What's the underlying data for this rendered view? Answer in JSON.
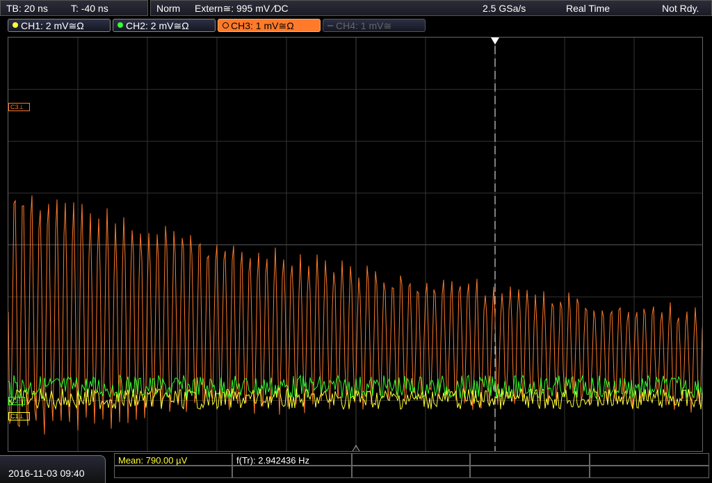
{
  "topbar": {
    "timebase": "TB: 20 ns",
    "trigger_time": "T: -40 ns",
    "mode": "Norm",
    "source": "Extern≅: 995 mV ⁄DC",
    "sample_rate": "2.5 GSa/s",
    "acq_mode": "Real Time",
    "status": "Not Rdy."
  },
  "channels": [
    {
      "label": "CH1: 2 mV≅Ω",
      "color": "#ffff33",
      "state": "on"
    },
    {
      "label": "CH2: 2 mV≅Ω",
      "color": "#33ff33",
      "state": "on"
    },
    {
      "label": "CH3: 1 mV≅Ω",
      "color": "#ff7a2a",
      "state": "selected"
    },
    {
      "label": "CH4: 1 mV≅",
      "color": "#555555",
      "state": "off"
    }
  ],
  "markers": {
    "c3": "C3",
    "c2": "C2",
    "c1": "C1"
  },
  "footer": {
    "datetime": "2016-11-03 09:40",
    "measure1": "Mean: 790.00 µV",
    "measure2": "f(Tr): 2.942436 Hz"
  }
}
